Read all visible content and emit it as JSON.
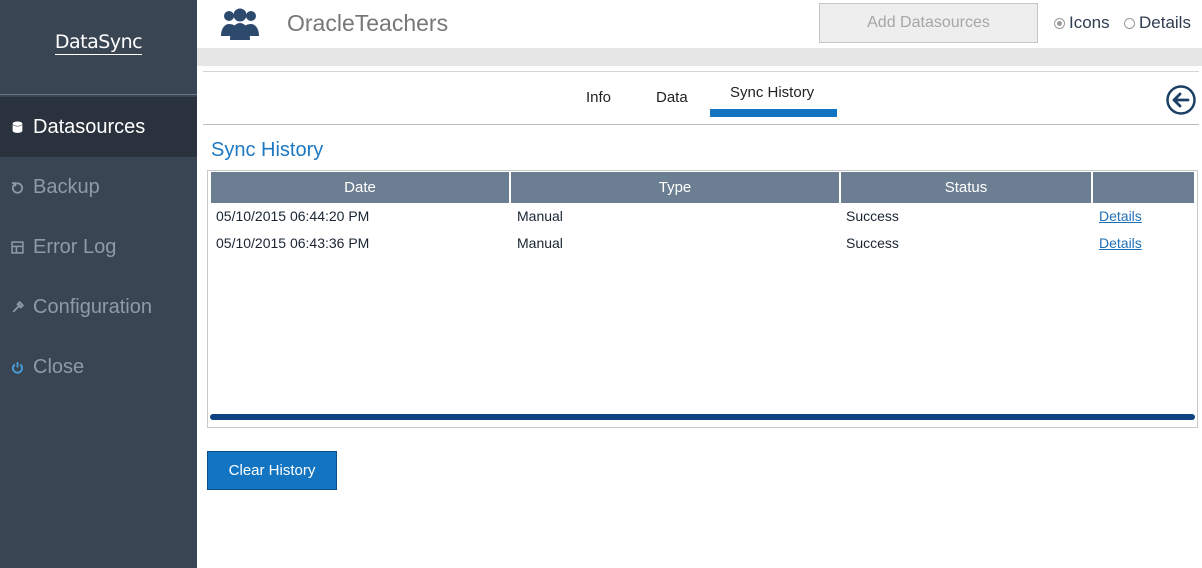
{
  "sidebar": {
    "logo": "DataSync",
    "items": [
      {
        "label": "Datasources",
        "icon": "database-icon",
        "active": true
      },
      {
        "label": "Backup",
        "icon": "backup-icon",
        "active": false
      },
      {
        "label": "Error Log",
        "icon": "log-icon",
        "active": false
      },
      {
        "label": "Configuration",
        "icon": "tools-icon",
        "active": false
      },
      {
        "label": "Close",
        "icon": "power-icon",
        "active": false
      }
    ]
  },
  "header": {
    "title": "OracleTeachers",
    "icon": "users-icon",
    "add_button": "Add Datasources",
    "view_options": [
      {
        "label": "Icons",
        "checked": true
      },
      {
        "label": "Details",
        "checked": false
      }
    ]
  },
  "tabs": [
    {
      "label": "Info",
      "active": false
    },
    {
      "label": "Data",
      "active": false
    },
    {
      "label": "Sync History",
      "active": true
    }
  ],
  "section": {
    "title": "Sync History",
    "columns": [
      "Date",
      "Type",
      "Status",
      ""
    ],
    "rows": [
      {
        "date": "05/10/2015 06:44:20 PM",
        "type": "Manual",
        "status": "Success",
        "action": "Details"
      },
      {
        "date": "05/10/2015 06:43:36 PM",
        "type": "Manual",
        "status": "Success",
        "action": "Details"
      }
    ],
    "clear_button": "Clear History"
  },
  "colors": {
    "sidebar_bg": "#3a4553",
    "sidebar_active": "#2a323d",
    "accent": "#1375c2",
    "grid_header": "#6c7e92",
    "title_blue": "#1e78c2"
  }
}
